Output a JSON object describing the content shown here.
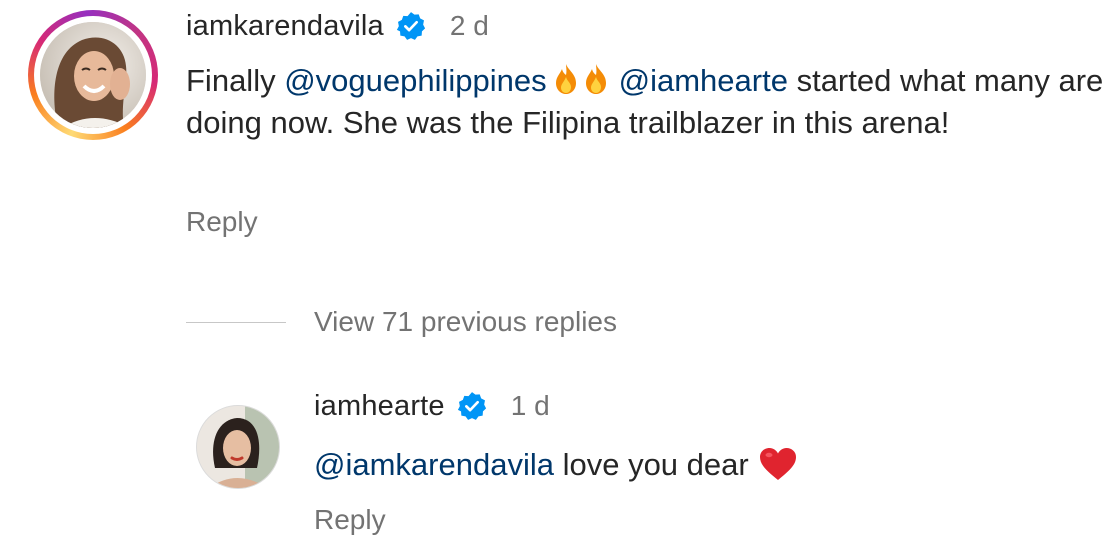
{
  "main_comment": {
    "username": "iamkarendavila",
    "verified": true,
    "time": "2 d",
    "text_parts": {
      "lead": "Finally ",
      "mention1": "@voguephilippines",
      "emoji": "fire-emoji x2",
      "mention2": "@iamhearte",
      "tail": " started what many are doing now. She was the Filipina trailblazer in this arena!"
    },
    "reply_label": "Reply"
  },
  "view_replies": {
    "label": "View 71 previous replies"
  },
  "reply_comment": {
    "username": "iamhearte",
    "verified": true,
    "time": "1 d",
    "mention": "@iamkarendavila",
    "text": " love you dear",
    "emoji": "red-heart-emoji",
    "reply_label": "Reply"
  },
  "colors": {
    "text": "#262626",
    "secondary": "#737373",
    "mention": "#00376b",
    "verified_blue": "#0095f6",
    "heart_red": "#e0242f",
    "story_ring": [
      "#feda75",
      "#fa7e1e",
      "#d62976",
      "#962fbf"
    ]
  }
}
